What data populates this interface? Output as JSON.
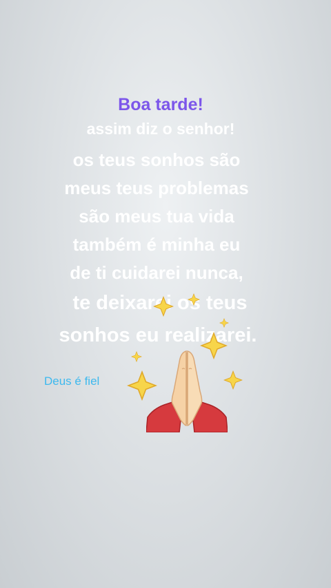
{
  "story": {
    "greeting": "Boa tarde!",
    "subtitle": "assim diz o senhor!",
    "message_lines": [
      "os teus sonhos são",
      "meus teus problemas",
      "são meus tua vida",
      "também é minha eu",
      "de ti cuidarei nunca,",
      "te deixarei os teus",
      "sonhos eu realizarei."
    ],
    "tagline": "Deus é fiel",
    "stickers": [
      "sparkles-icon",
      "praying-hands-icon"
    ]
  },
  "colors": {
    "greeting": "#7c56ea",
    "message": "#ffffff",
    "tagline": "#3eb9ee",
    "background": "#dde1e4"
  }
}
